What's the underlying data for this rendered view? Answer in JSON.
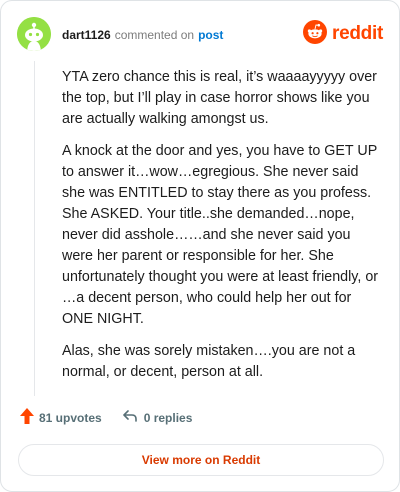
{
  "header": {
    "username": "dart1126",
    "commented_on": "commented on",
    "post_link": "post",
    "brand": "reddit"
  },
  "comment": {
    "paragraphs": [
      "YTA zero chance this is real, it’s waaaayyyyy over the top, but I’ll play in case horror shows like you are actually walking amongst us.",
      "A knock at the door and yes, you have to GET UP to answer it…wow…egregious. She never said she was ENTITLED to stay there as you profess. She ASKED. Your title..she demanded…nope, never did asshole……and she never said you were her parent or responsible for her. She unfortunately thought you were at least friendly, or …a decent person, who could help her out for ONE NIGHT.",
      "Alas, she was sorely mistaken….you are not a normal, or decent, person at all."
    ]
  },
  "actions": {
    "upvotes": "81 upvotes",
    "replies": "0 replies"
  },
  "footer": {
    "view_more": "View more on Reddit"
  },
  "colors": {
    "brand": "#ff4500",
    "avatar": "#94e044",
    "link": "#0079d3",
    "cta": "#d93a00"
  },
  "icons": {
    "avatar": "snoo-avatar-icon",
    "brand": "reddit-logo-icon",
    "upvote": "upvote-arrow-icon",
    "reply": "reply-arrow-icon"
  }
}
